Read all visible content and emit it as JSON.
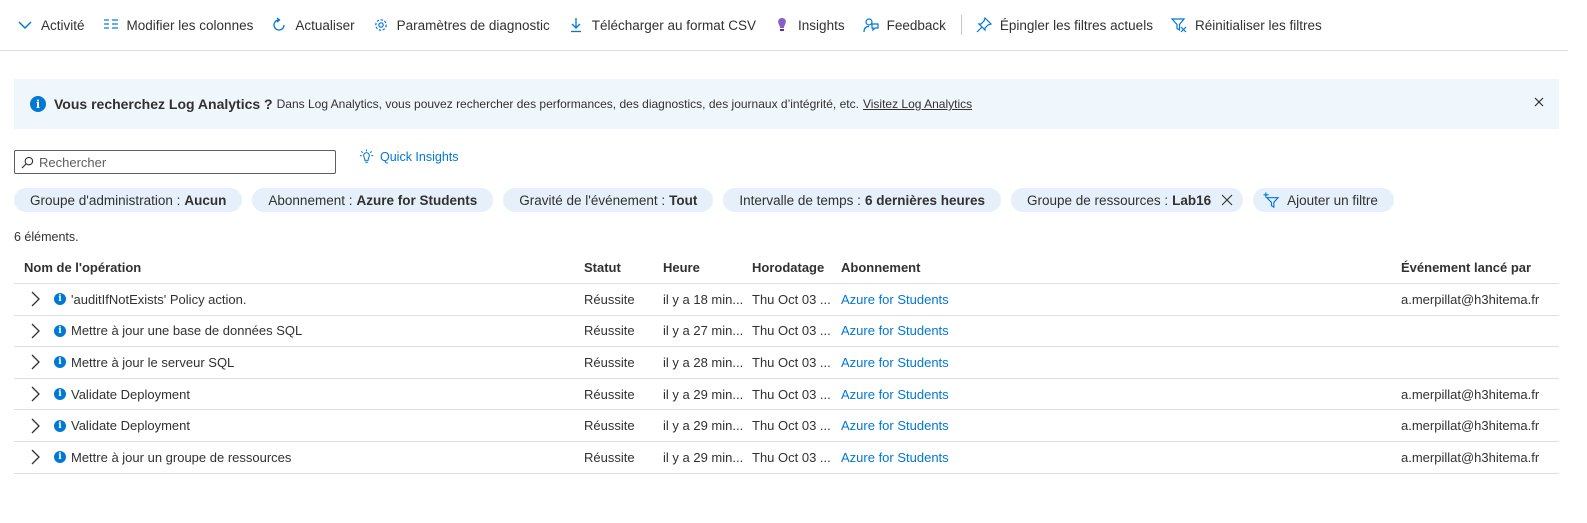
{
  "toolbar": {
    "items": [
      {
        "label": "Activité",
        "icon": "chevron-down-icon"
      },
      {
        "label": "Modifier les colonnes",
        "icon": "columns-icon"
      },
      {
        "label": "Actualiser",
        "icon": "refresh-icon"
      },
      {
        "label": "Paramètres de diagnostic",
        "icon": "gear-icon"
      },
      {
        "label": "Télécharger au format CSV",
        "icon": "download-icon"
      },
      {
        "label": "Insights",
        "icon": "lightbulb-icon"
      },
      {
        "label": "Feedback",
        "icon": "feedback-icon"
      },
      {
        "label": "Épingler les filtres actuels",
        "icon": "pin-icon"
      },
      {
        "label": "Réinitialiser les filtres",
        "icon": "clear-filter-icon"
      }
    ]
  },
  "banner": {
    "title": "Vous recherchez Log Analytics ?",
    "text": "Dans Log Analytics, vous pouvez rechercher des performances, des diagnostics, des journaux d’intégrité, etc.",
    "link": "Visitez Log Analytics"
  },
  "search": {
    "placeholder": "Rechercher",
    "value": ""
  },
  "quick_insights": "Quick Insights",
  "filters": [
    {
      "label": "Groupe d'administration :",
      "value": "Aucun"
    },
    {
      "label": "Abonnement :",
      "value": "Azure for Students"
    },
    {
      "label": "Gravité de l'événement :",
      "value": "Tout"
    },
    {
      "label": "Intervalle de temps :",
      "value": "6 dernières heures"
    },
    {
      "label": "Groupe de ressources :",
      "value": "Lab16"
    }
  ],
  "add_filter": "Ajouter un filtre",
  "count": "6 éléments.",
  "table": {
    "headers": {
      "name": "Nom de l'opération",
      "status": "Statut",
      "time": "Heure",
      "stamp": "Horodatage",
      "subscription": "Abonnement",
      "by": "Événement lancé par"
    },
    "rows": [
      {
        "name": "'auditIfNotExists' Policy action.",
        "status": "Réussite",
        "time": "il y a 18 min...",
        "stamp": "Thu Oct 03 ...",
        "subscription": "Azure for Students",
        "by": "a.merpillat@h3hitema.fr"
      },
      {
        "name": "Mettre à jour une base de données SQL",
        "status": "Réussite",
        "time": "il y a 27 min...",
        "stamp": "Thu Oct 03 ...",
        "subscription": "Azure for Students",
        "by": ""
      },
      {
        "name": "Mettre à jour le serveur SQL",
        "status": "Réussite",
        "time": "il y a 28 min...",
        "stamp": "Thu Oct 03 ...",
        "subscription": "Azure for Students",
        "by": ""
      },
      {
        "name": "Validate Deployment",
        "status": "Réussite",
        "time": "il y a 29 min...",
        "stamp": "Thu Oct 03 ...",
        "subscription": "Azure for Students",
        "by": "a.merpillat@h3hitema.fr"
      },
      {
        "name": "Validate Deployment",
        "status": "Réussite",
        "time": "il y a 29 min...",
        "stamp": "Thu Oct 03 ...",
        "subscription": "Azure for Students",
        "by": "a.merpillat@h3hitema.fr"
      },
      {
        "name": "Mettre à jour un groupe de ressources",
        "status": "Réussite",
        "time": "il y a 29 min...",
        "stamp": "Thu Oct 03 ...",
        "subscription": "Azure for Students",
        "by": "a.merpillat@h3hitema.fr"
      }
    ]
  },
  "colors": {
    "accent": "#0078d4",
    "banner_bg": "#eff6fc",
    "pill_bg": "#e5f0fb"
  }
}
